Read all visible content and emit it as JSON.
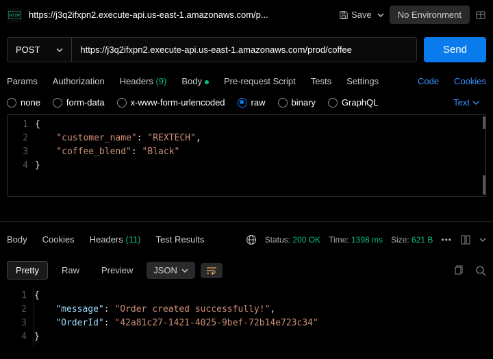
{
  "topbar": {
    "tab_title": "https://j3q2ifxpn2.execute-api.us-east-1.amazonaws.com/p...",
    "save_label": "Save",
    "env_label": "No Environment"
  },
  "request": {
    "method": "POST",
    "url": "https://j3q2ifxpn2.execute-api.us-east-1.amazonaws.com/prod/coffee",
    "send_label": "Send"
  },
  "tabs": {
    "params": "Params",
    "authorization": "Authorization",
    "headers_label": "Headers",
    "headers_count": "(9)",
    "body": "Body",
    "prerequest": "Pre-request Script",
    "tests": "Tests",
    "settings": "Settings",
    "code": "Code",
    "cookies": "Cookies"
  },
  "body_types": {
    "none": "none",
    "form_data": "form-data",
    "xwww": "x-www-form-urlencoded",
    "raw": "raw",
    "binary": "binary",
    "graphql": "GraphQL",
    "text_dd": "Text"
  },
  "request_body": {
    "line1": "{",
    "l2_k": "\"customer_name\"",
    "l2_v": "\"REXTECH\"",
    "l3_k": "\"coffee_blend\"",
    "l3_v": "\"Black\"",
    "line4": "}"
  },
  "response": {
    "tabs": {
      "body": "Body",
      "cookies": "Cookies",
      "headers_label": "Headers",
      "headers_count": "(11)",
      "test_results": "Test Results"
    },
    "status": {
      "status_label": "Status:",
      "status_value": "200 OK",
      "time_label": "Time:",
      "time_value": "1398 ms",
      "size_label": "Size:",
      "size_value": "621 B"
    },
    "view": {
      "pretty": "Pretty",
      "raw": "Raw",
      "preview": "Preview",
      "json": "JSON"
    },
    "body": {
      "line1": "{",
      "l2_k": "\"message\"",
      "l2_v": "\"Order created successfully!\"",
      "l3_k": "\"OrderId\"",
      "l3_v": "\"42a81c27-1421-4025-9bef-72b14e723c34\"",
      "line4": "}"
    }
  }
}
